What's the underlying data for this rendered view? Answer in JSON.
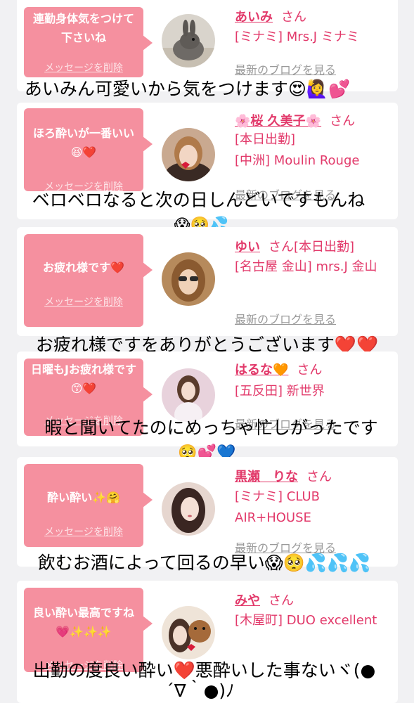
{
  "delete_label": "メッセージを削除",
  "blog_label": "最新のブログを見る",
  "honorific": "さん",
  "entries": [
    {
      "message": "連勤身体気をつけて下さいね",
      "name": "あいみ",
      "info": [
        "[ミナミ] Mrs.J ミナミ"
      ],
      "comment": "あいみん可愛いから気をつけます😍🙋‍♀️💕"
    },
    {
      "message": "ほろ酔いが一番いい😆❤️",
      "name": "🌸桜 久美子🌸",
      "info": [
        "[本日出勤]",
        "[中洲] Moulin Rouge"
      ],
      "comment": "ベロベロなると次の日しんどいですもんね",
      "comment2": "😱🥺💦"
    },
    {
      "message": "お疲れ様です❤️",
      "name": "ゆい",
      "name_suffix": "[本日出勤]",
      "info": [
        "[名古屋 金山] mrs.J 金山"
      ],
      "comment": "お疲れ様ですをありがとうございます❤️❤️"
    },
    {
      "message": "日曜もJお疲れ様です😙❤️",
      "name": "はるな🧡",
      "info": [
        "[五反田] 新世界"
      ],
      "comment": "暇と聞いてたのにめっちゃ忙しがったです",
      "comment2": "🥺💕💙"
    },
    {
      "message": "酔い酔い✨🤗",
      "name": "黒瀬　りな",
      "info": [
        "[ミナミ] CLUB AIR+HOUSE"
      ],
      "comment": "飲むお酒によって回るの早い😱🥺💦💦💦"
    },
    {
      "message": "良い酔い最高ですね💗✨✨✨",
      "name": "みや",
      "info": [
        "[木屋町] DUO excellent"
      ],
      "comment": "出勤の度良い酔い❤️悪酔いした事ないヾ(●",
      "comment2": "´∇｀●)ﾉ"
    }
  ],
  "colors": {
    "bubble": "#f5909f",
    "name": "#e2396a",
    "link_gray": "#9a9a9a",
    "page_bg": "#f1f1f3"
  }
}
